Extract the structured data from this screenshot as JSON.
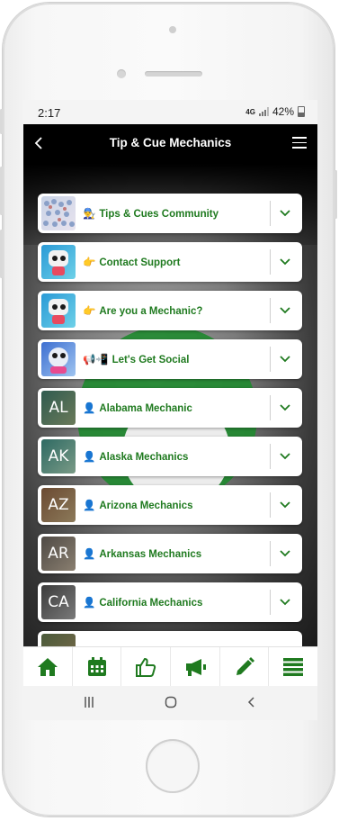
{
  "status": {
    "time": "2:17",
    "network": "4G",
    "battery": "42%"
  },
  "header": {
    "title": "Tip & Cue Mechanics"
  },
  "items": [
    {
      "emoji": "👨‍🔧",
      "label": "Tips & Cues Community",
      "thumb": "crowd"
    },
    {
      "emoji": "👉",
      "label": "Contact Support",
      "thumb": "robot"
    },
    {
      "emoji": "👉",
      "label": "Are you a Mechanic?",
      "thumb": "robot"
    },
    {
      "emoji": "📢📲",
      "label": "Let's Get Social",
      "thumb": "robot2"
    },
    {
      "emoji": "👤",
      "label": "Alabama Mechanic",
      "thumb": "AL"
    },
    {
      "emoji": "👤",
      "label": "Alaska Mechanics",
      "thumb": "AK"
    },
    {
      "emoji": "👤",
      "label": "Arizona Mechanics",
      "thumb": "AZ"
    },
    {
      "emoji": "👤",
      "label": "Arkansas Mechanics",
      "thumb": "AR"
    },
    {
      "emoji": "👤",
      "label": "California Mechanics",
      "thumb": "CA"
    }
  ],
  "tabs": [
    {
      "icon": "home-icon"
    },
    {
      "icon": "calendar-icon"
    },
    {
      "icon": "thumbs-up-icon"
    },
    {
      "icon": "megaphone-icon"
    },
    {
      "icon": "pencil-icon"
    },
    {
      "icon": "list-icon"
    }
  ],
  "colors": {
    "accent": "#1f7a1f",
    "appbar": "#000000"
  }
}
